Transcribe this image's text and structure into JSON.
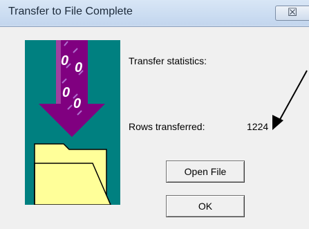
{
  "window": {
    "title": "Transfer to File Complete",
    "close_glyph": "☒"
  },
  "stats": {
    "heading": "Transfer statistics:",
    "rows_label": "Rows transferred:",
    "rows_value": "1224"
  },
  "buttons": {
    "open_file": "Open File",
    "ok": "OK"
  },
  "art": {
    "digits": [
      "0",
      "0",
      "0",
      "0"
    ],
    "colors": {
      "teal_bg": "#008080",
      "arrow": "#7f007f",
      "folder": "#ffff99"
    }
  }
}
